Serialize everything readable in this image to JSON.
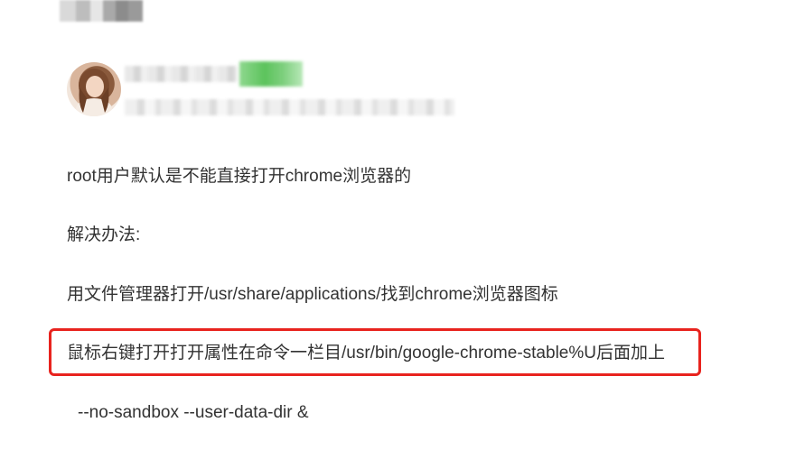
{
  "article": {
    "paragraphs": [
      "root用户默认是不能直接打开chrome浏览器的",
      "解决办法:",
      "用文件管理器打开/usr/share/applications/找到chrome浏览器图标",
      "鼠标右键打开打开属性在命令一栏目/usr/bin/google-chrome-stable%U后面加上",
      "--no-sandbox --user-data-dir &"
    ]
  },
  "colors": {
    "text": "#333333",
    "highlight_border": "#e8231e",
    "badge_green": "#5cc35c"
  }
}
